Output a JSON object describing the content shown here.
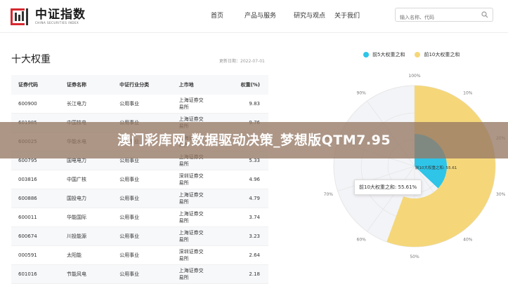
{
  "header": {
    "logo_cn": "中证指数",
    "logo_en": "CHINA SECURITIES INDEX",
    "nav": [
      "首页",
      "产品与服务",
      "研究与观点",
      "关于我们"
    ],
    "search_placeholder": "输入名称、代码"
  },
  "table": {
    "title": "十大权重",
    "update_time": "更新日期：2022-07-01",
    "columns": [
      "证券代码",
      "证券名称",
      "中证行业分类",
      "上市地",
      "权重(%)"
    ],
    "rows": [
      {
        "code": "600900",
        "name": "长江电力",
        "industry": "公用事业",
        "market": [
          "上海证券交",
          "易所"
        ],
        "weight": "9.83"
      },
      {
        "code": "601985",
        "name": "中国核电",
        "industry": "公用事业",
        "market": [
          "上海证券交",
          "易所"
        ],
        "weight": "9.76"
      },
      {
        "code": "600025",
        "name": "华能水电",
        "industry": "公用事业",
        "market": [
          "上海证券交",
          "易所"
        ],
        "weight": ""
      },
      {
        "code": "600795",
        "name": "国电电力",
        "industry": "公用事业",
        "market": [
          "上海证券交",
          "易所"
        ],
        "weight": "5.33"
      },
      {
        "code": "003816",
        "name": "中国广核",
        "industry": "公用事业",
        "market": [
          "深圳证券交",
          "易所"
        ],
        "weight": "4.96"
      },
      {
        "code": "600886",
        "name": "国投电力",
        "industry": "公用事业",
        "market": [
          "上海证券交",
          "易所"
        ],
        "weight": "4.79"
      },
      {
        "code": "600011",
        "name": "华能国际",
        "industry": "公用事业",
        "market": [
          "上海证券交",
          "易所"
        ],
        "weight": "3.74"
      },
      {
        "code": "600674",
        "name": "川投能源",
        "industry": "公用事业",
        "market": [
          "上海证券交",
          "易所"
        ],
        "weight": "3.23"
      },
      {
        "code": "000591",
        "name": "太阳能",
        "industry": "公用事业",
        "market": [
          "深圳证券交",
          "易所"
        ],
        "weight": "2.64"
      },
      {
        "code": "601016",
        "name": "节能风电",
        "industry": "公用事业",
        "market": [
          "上海证券交",
          "易所"
        ],
        "weight": "2.18"
      }
    ]
  },
  "chart_data": {
    "type": "pie",
    "legend": [
      "前5大权重之和",
      "前10大权重之和"
    ],
    "series": [
      {
        "name": "前5大权重之和",
        "value": 37.0,
        "color": "#2ec5e8"
      },
      {
        "name": "前10大权重之和",
        "value": 55.61,
        "color": "#f5d77a"
      }
    ],
    "radial_ticks": [
      "100%",
      "10%",
      "20%",
      "30%",
      "40%",
      "50%",
      "60%",
      "70%",
      "80%",
      "90%"
    ],
    "inner_label": "前10大权重之和: 55.61",
    "tooltip": "前10大权重之和: 55.61%",
    "legend_placement": "top-right"
  },
  "banner": {
    "text": "澳门彩库网,数据驱动决策_梦想版QTM7.95"
  },
  "colors": {
    "top5": "#2ec5e8",
    "top10": "#f5d77a",
    "logo_red": "#d7282f"
  }
}
